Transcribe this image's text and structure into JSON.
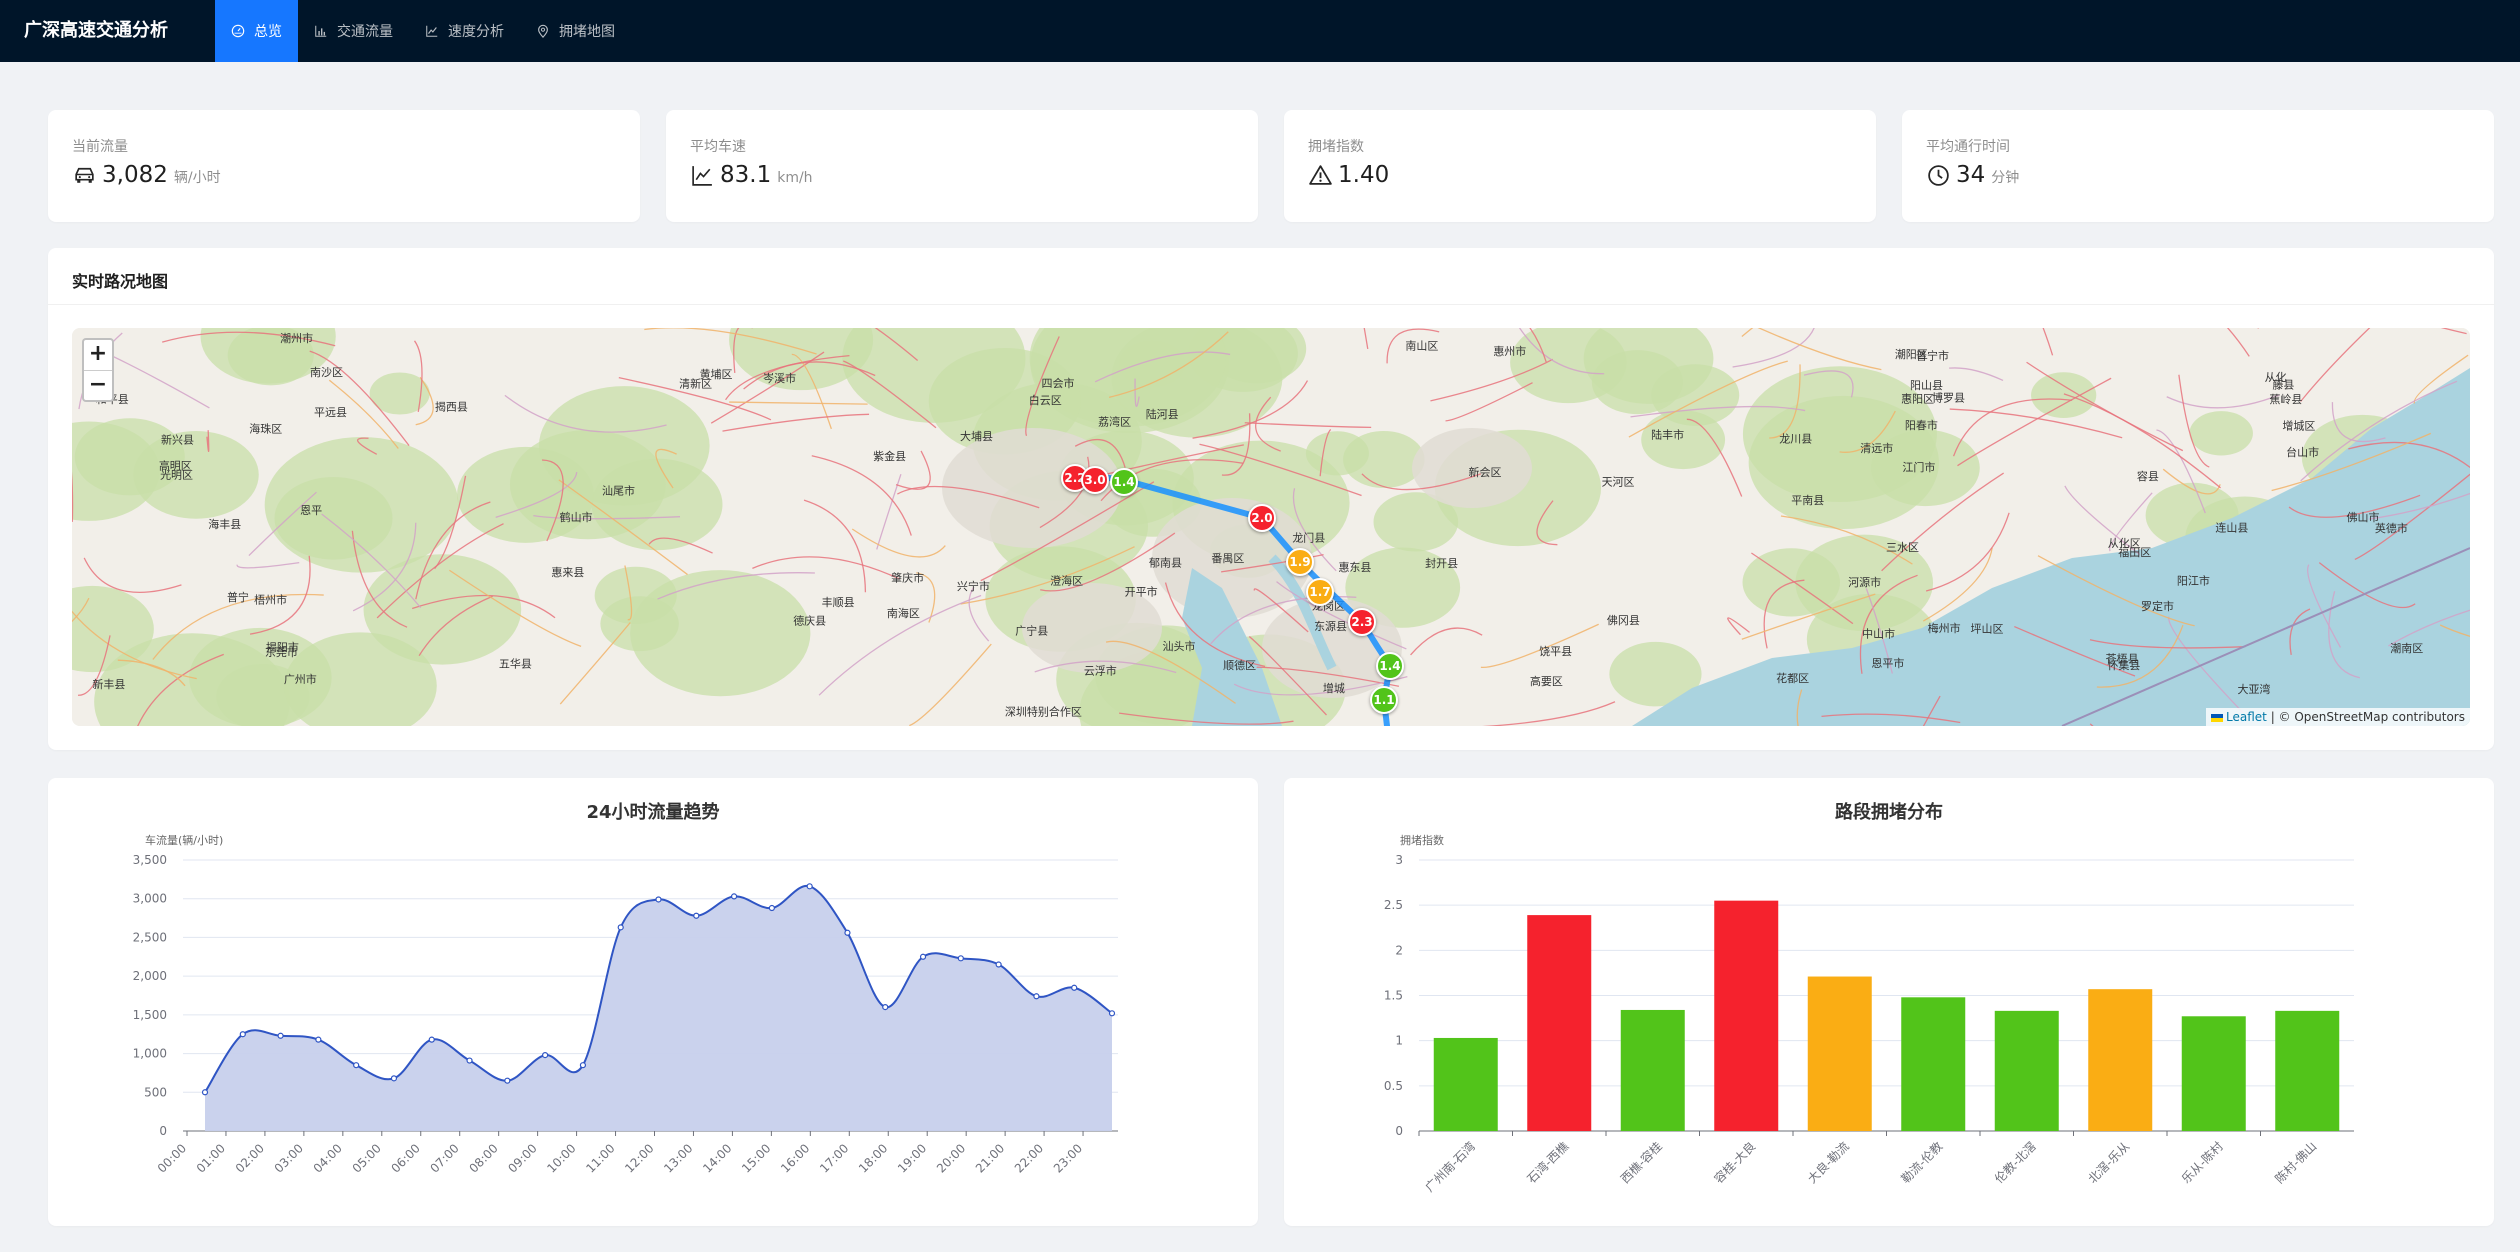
{
  "header": {
    "title": "广深高速交通分析",
    "nav": [
      {
        "label": "总览",
        "icon": "dashboard-icon",
        "active": true
      },
      {
        "label": "交通流量",
        "icon": "bar-chart-icon",
        "active": false
      },
      {
        "label": "速度分析",
        "icon": "line-chart-icon",
        "active": false
      },
      {
        "label": "拥堵地图",
        "icon": "location-pin-icon",
        "active": false
      }
    ]
  },
  "stats": [
    {
      "title": "当前流量",
      "value": "3,082",
      "unit": "辆/小时",
      "icon": "car-icon"
    },
    {
      "title": "平均车速",
      "value": "83.1",
      "unit": "km/h",
      "icon": "line-chart-icon"
    },
    {
      "title": "拥堵指数",
      "value": "1.40",
      "unit": "",
      "icon": "warning-icon"
    },
    {
      "title": "平均通行时间",
      "value": "34",
      "unit": "分钟",
      "icon": "clock-icon"
    }
  ],
  "map": {
    "title": "实时路况地图",
    "zoom_in": "+",
    "zoom_out": "−",
    "attribution_leaflet": "Leaflet",
    "attribution_rest": " | © OpenStreetMap contributors",
    "markers": [
      "2.2",
      "3.0",
      "1.4",
      "2.0",
      "1.9",
      "1.7",
      "2.3",
      "1.4",
      "1.1"
    ],
    "marker_colors": {
      "red": "#f5222d",
      "orange": "#faad14",
      "green": "#52c41a"
    },
    "route_color": "#1890ff",
    "place_labels": [
      "梧州市",
      "封开县",
      "怀集县",
      "四会市",
      "花都区",
      "从化区",
      "龙门县",
      "河源市",
      "东源县",
      "龙川县",
      "和平县",
      "五华县",
      "兴宁市",
      "梅州市",
      "揭西县",
      "普宁市",
      "汕头市",
      "潮阳区",
      "德庆县",
      "肇庆市",
      "广宁县",
      "清新区",
      "三水区",
      "南海区",
      "佛山市",
      "广州市",
      "增城区",
      "博罗县",
      "惠州市",
      "惠东县",
      "海丰县",
      "陆丰市",
      "陆河县",
      "揭阳市",
      "高要区",
      "高明区",
      "鹤山市",
      "江门市",
      "新会区",
      "中山市",
      "顺德区",
      "番禺区",
      "南沙区",
      "东莞市",
      "光明区",
      "龙岗区",
      "福田区",
      "南山区",
      "深圳特别合作区",
      "汕尾市",
      "云浮市",
      "新兴县",
      "开平市",
      "台山市",
      "恩平市",
      "罗定市",
      "郁南县",
      "藤县",
      "苍梧县",
      "岑溪市",
      "容县",
      "平南县",
      "惠阳区",
      "大亚湾",
      "坪山区",
      "黄埔区",
      "白云区",
      "荔湾区",
      "海珠区",
      "天河区",
      "从化",
      "增城",
      "新丰县",
      "佛冈县",
      "英德市",
      "阳山县",
      "连山县",
      "清远市",
      "紫金县",
      "普宁",
      "惠来县",
      "潮南区",
      "澄海区",
      "饶平县",
      "潮州市",
      "丰顺县",
      "大埔县",
      "蕉岭县",
      "平远县",
      "阳春市",
      "阳江市",
      "恩平"
    ]
  },
  "flow_chart": {
    "title": "24小时流量趋势",
    "chart_data": {
      "type": "area",
      "title": "24小时流量趋势",
      "ylabel": "车流量(辆/小时)",
      "xlabel": "",
      "ylim": [
        0,
        3500
      ],
      "yticks": [
        "0",
        "500",
        "1,000",
        "1,500",
        "2,000",
        "2,500",
        "3,000",
        "3,500"
      ],
      "categories": [
        "00:00",
        "01:00",
        "02:00",
        "03:00",
        "04:00",
        "05:00",
        "06:00",
        "07:00",
        "08:00",
        "09:00",
        "10:00",
        "11:00",
        "12:00",
        "13:00",
        "14:00",
        "15:00",
        "16:00",
        "17:00",
        "18:00",
        "19:00",
        "20:00",
        "21:00",
        "22:00",
        "23:00"
      ],
      "x_values_half_hour": [
        "00:00",
        "00:30",
        "01:00",
        "01:30",
        "02:00",
        "02:30",
        "03:00",
        "03:30",
        "04:00",
        "04:30",
        "05:00",
        "05:30",
        "06:00",
        "06:30",
        "07:00",
        "07:30",
        "08:00",
        "08:30",
        "09:00",
        "09:30",
        "10:00",
        "10:30",
        "11:00",
        "11:30",
        "12:00",
        "12:30",
        "13:00",
        "13:30",
        "14:00",
        "14:30",
        "15:00",
        "15:30",
        "16:00",
        "16:30",
        "17:00",
        "17:30",
        "18:00",
        "18:30",
        "19:00",
        "19:30",
        "20:00",
        "20:30",
        "21:00",
        "21:30",
        "22:00",
        "22:30",
        "23:00"
      ],
      "values": [
        500,
        1250,
        1230,
        1180,
        850,
        680,
        1180,
        910,
        650,
        980,
        850,
        2630,
        2990,
        2780,
        3030,
        2880,
        3160,
        2560,
        1600,
        2250,
        2230,
        2150,
        1740,
        1850,
        1520
      ],
      "series_color": "#2f55c4",
      "fill_color": "#c7d0ec",
      "grid": true
    }
  },
  "congestion_chart": {
    "title": "路段拥堵分布",
    "chart_data": {
      "type": "bar",
      "title": "路段拥堵分布",
      "ylabel": "拥堵指数",
      "xlabel": "",
      "ylim": [
        0,
        3
      ],
      "yticks": [
        "0",
        "0.5",
        "1",
        "1.5",
        "2",
        "2.5",
        "3"
      ],
      "categories": [
        "广州南-石湾",
        "石湾-西樵",
        "西樵-容桂",
        "容桂-大良",
        "大良-勒流",
        "勒流-伦教",
        "伦教-北滘",
        "北滘-乐从",
        "乐从-陈村",
        "陈村-佛山"
      ],
      "values": [
        1.03,
        2.39,
        1.34,
        2.55,
        1.71,
        1.48,
        1.33,
        1.57,
        1.27,
        1.33
      ],
      "colors": [
        "#52c41a",
        "#f5222d",
        "#52c41a",
        "#f5222d",
        "#faad14",
        "#52c41a",
        "#52c41a",
        "#faad14",
        "#52c41a",
        "#52c41a"
      ],
      "grid": true
    }
  }
}
